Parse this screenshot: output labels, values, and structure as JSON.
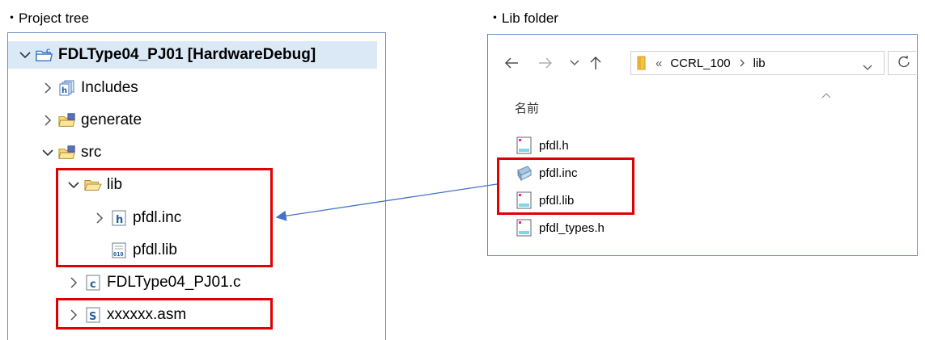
{
  "captions": {
    "project_tree": "・Project tree",
    "lib_folder": "・Lib folder"
  },
  "tree": {
    "project": "FDLType04_PJ01 [HardwareDebug]",
    "includes": "Includes",
    "generate": "generate",
    "src": "src",
    "lib": "lib",
    "pfdl_inc": "pfdl.inc",
    "pfdl_lib": "pfdl.lib",
    "c_file": "FDLType04_PJ01.c",
    "asm_file": "xxxxxx.asm"
  },
  "explorer": {
    "breadcrumb_prefix": "«",
    "crumb1": "CCRL_100",
    "crumb2": "lib",
    "column_name": "名前",
    "files": [
      "pfdl.h",
      "pfdl.inc",
      "pfdl.lib",
      "pfdl_types.h"
    ]
  },
  "colors": {
    "highlight": "#e00000",
    "arrow": "#4472c4",
    "selection": "#dbe9f7",
    "panel_border": "#6a8fc4"
  }
}
